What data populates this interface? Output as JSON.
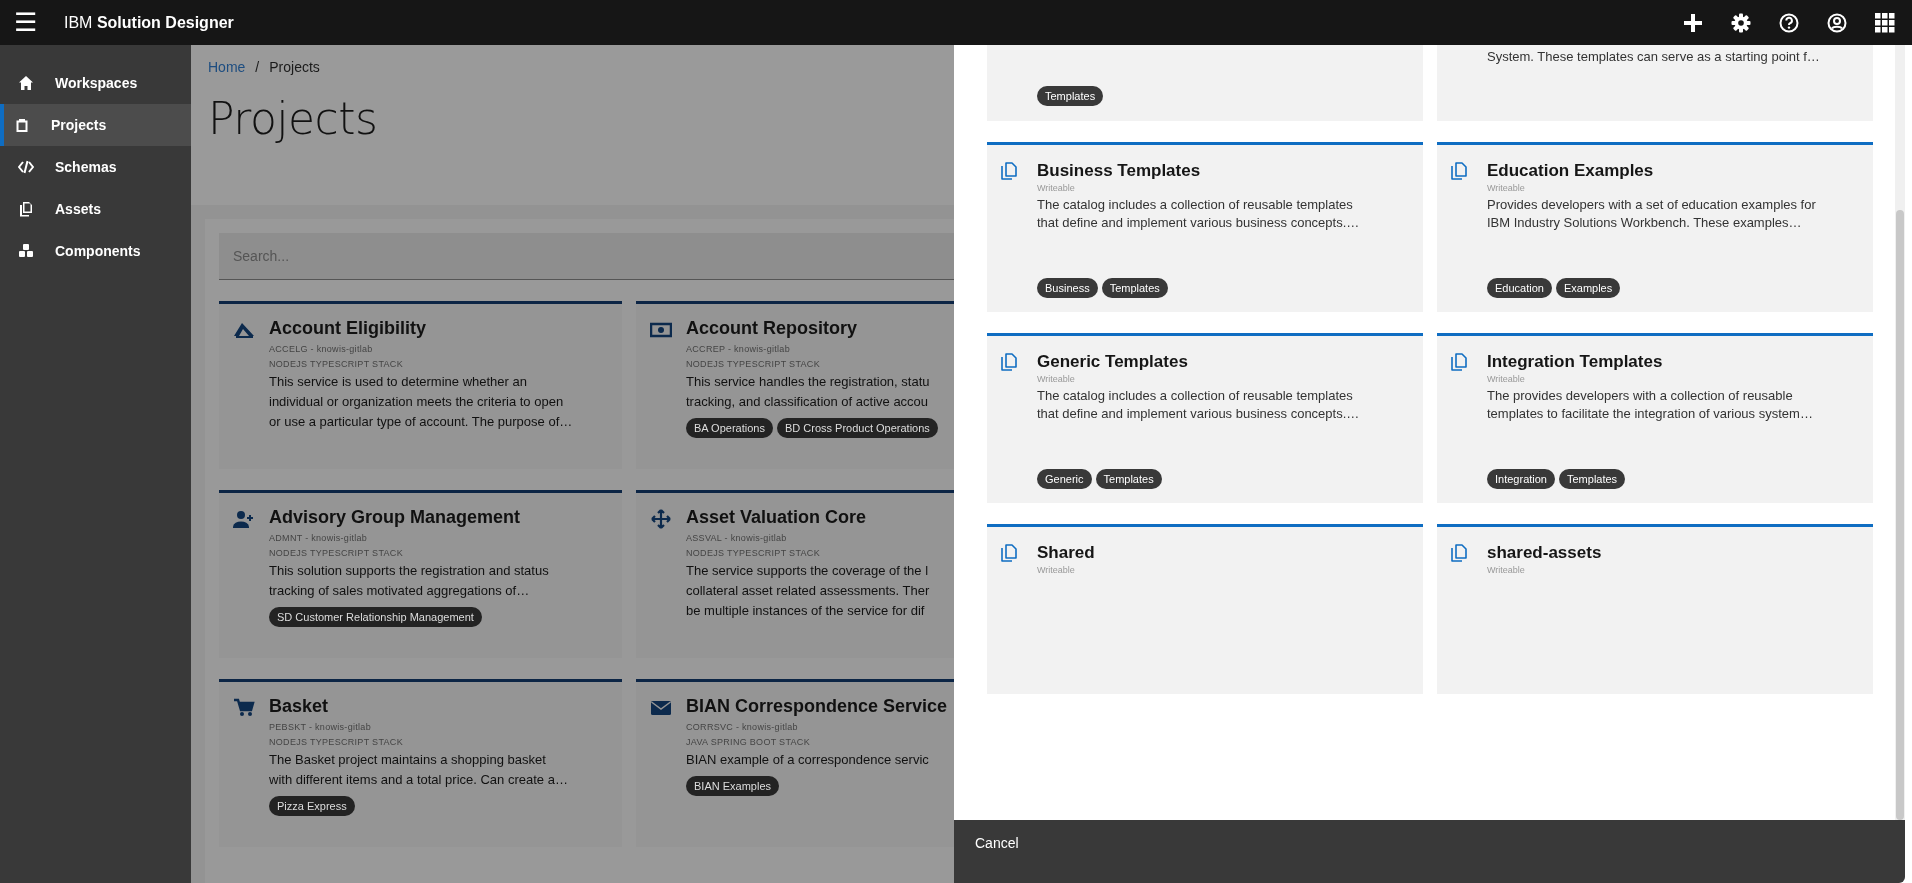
{
  "header": {
    "menu_icon": "☰",
    "title": "IBM **Solution Designer**"
  },
  "sidebar": {
    "items": [
      {
        "label": "Workspaces",
        "selected": false
      },
      {
        "label": "Projects",
        "selected": true
      },
      {
        "label": "Schemas",
        "selected": false
      },
      {
        "label": "Assets",
        "selected": false
      },
      {
        "label": "Components",
        "selected": false
      }
    ]
  },
  "breadcrumb": [
    {
      "label": "Home",
      "kind": "link"
    },
    {
      "label": "Projects",
      "kind": "current"
    }
  ],
  "breadcrumb_separator": "/",
  "page_title": "Projects",
  "search": {
    "placeholder": "Search..."
  },
  "projects": [
    {
      "name": "Account Eligibility",
      "meta": "ACCELG - knowis-gitlab",
      "stack": "NODEJS TYPESCRIPT STACK",
      "description": "This service is used to determine whether an\nindividual or organization meets the criteria to open\nor use a particular type of account. The purpose of…"
    },
    {
      "name": "Account Repository",
      "meta": "ACCREP - knowis-gitlab",
      "stack": "NODEJS TYPESCRIPT STACK",
      "description": "This service handles the registration, statu\ntracking, and classification of active accou",
      "tags": [
        "BA Operations",
        "BD Cross Product Operations"
      ]
    },
    {
      "name": "Advisory Group Management",
      "meta": "ADMNT - knowis-gitlab",
      "stack": "NODEJS TYPESCRIPT STACK",
      "description": "This solution supports the registration and status\ntracking of sales motivated aggregations of…",
      "tags": [
        "SD Customer Relationship Management"
      ]
    },
    {
      "name": "Asset Valuation Core",
      "meta": "ASSVAL - knowis-gitlab",
      "stack": "NODEJS TYPESCRIPT STACK",
      "description": "The service supports the coverage of the l\ncollateral asset related assessments. Ther\nbe multiple instances of the service for dif"
    },
    {
      "name": "Basket",
      "meta": "PEBSKT - knowis-gitlab",
      "stack": "NODEJS TYPESCRIPT STACK",
      "description": "The Basket project maintains a shopping basket\nwith different items and a total price. Can create a…",
      "tags": [
        "Pizza Express"
      ]
    },
    {
      "name": "BIAN Correspondence Service",
      "meta": "CORRSVC - knowis-gitlab",
      "stack": "JAVA SPRING BOOT STACK",
      "description": "BIAN example of a correspondence servic",
      "tags": [
        "BIAN Examples"
      ]
    }
  ],
  "panel": {
    "catalogs": [
      {
        "kind": "partial",
        "tags": [
          "Templates"
        ]
      },
      {
        "kind": "partial",
        "description": "System. These templates can serve as a starting point f…"
      },
      {
        "kind": "full",
        "name": "Business Templates",
        "access": "Writeable",
        "description": "The catalog includes a collection of reusable templates\nthat define and implement various business concepts.…",
        "tags": [
          "Business",
          "Templates"
        ]
      },
      {
        "kind": "full",
        "name": "Education Examples",
        "access": "Writeable",
        "description": "Provides developers with a set of education examples for\nIBM Industry Solutions Workbench. These examples…",
        "tags": [
          "Education",
          "Examples"
        ]
      },
      {
        "kind": "full",
        "name": "Generic Templates",
        "access": "Writeable",
        "description": "The catalog includes a collection of reusable templates\nthat define and implement various business concepts.…",
        "tags": [
          "Generic",
          "Templates"
        ]
      },
      {
        "kind": "full",
        "name": "Integration Templates",
        "access": "Writeable",
        "description": "The provides developers with a collection of reusable\ntemplates to facilitate the integration of various system…",
        "tags": [
          "Integration",
          "Templates"
        ]
      },
      {
        "kind": "full",
        "name": "Shared",
        "access": "Writeable"
      },
      {
        "kind": "full",
        "name": "shared-assets",
        "access": "Writeable"
      }
    ],
    "cancel_button": "Cancel"
  }
}
